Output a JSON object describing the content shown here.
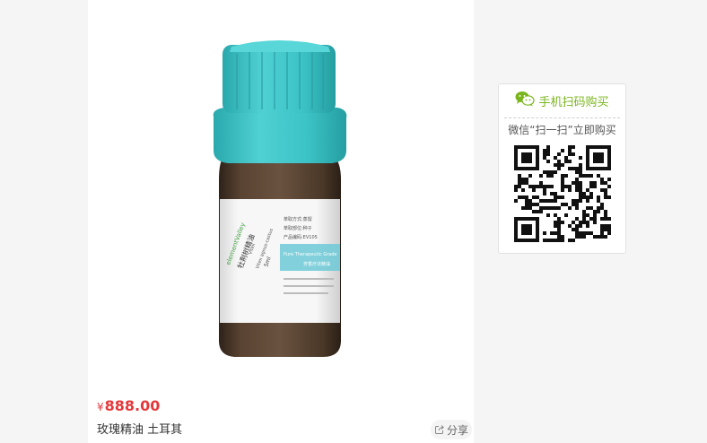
{
  "product": {
    "currency": "¥",
    "price": "888.00",
    "title": "玫瑰精油 土耳其",
    "share_label": "分享",
    "image_alt": "精油瓶"
  },
  "bottle_label": {
    "brand": "elementValley",
    "name_cn": "牡荆树精油",
    "name_en": "Vitex",
    "latin": "Vitex agnus-castus",
    "volume": "5ml",
    "band_text": "Pure Therapeutic Grade",
    "band_subtext": "芳香疗法精油",
    "info_lines": [
      "萃取方式:蒸馏",
      "萃取部位:种子",
      "产品编码:EV105"
    ]
  },
  "qr_panel": {
    "title": "手机扫码购买",
    "subtitle": "微信“扫一扫”立即购买"
  },
  "colors": {
    "price": "#e4393c",
    "wechat_green": "#7ab51d",
    "cap_teal": "#3cc3c6",
    "bottle_amber": "#4a3828"
  }
}
